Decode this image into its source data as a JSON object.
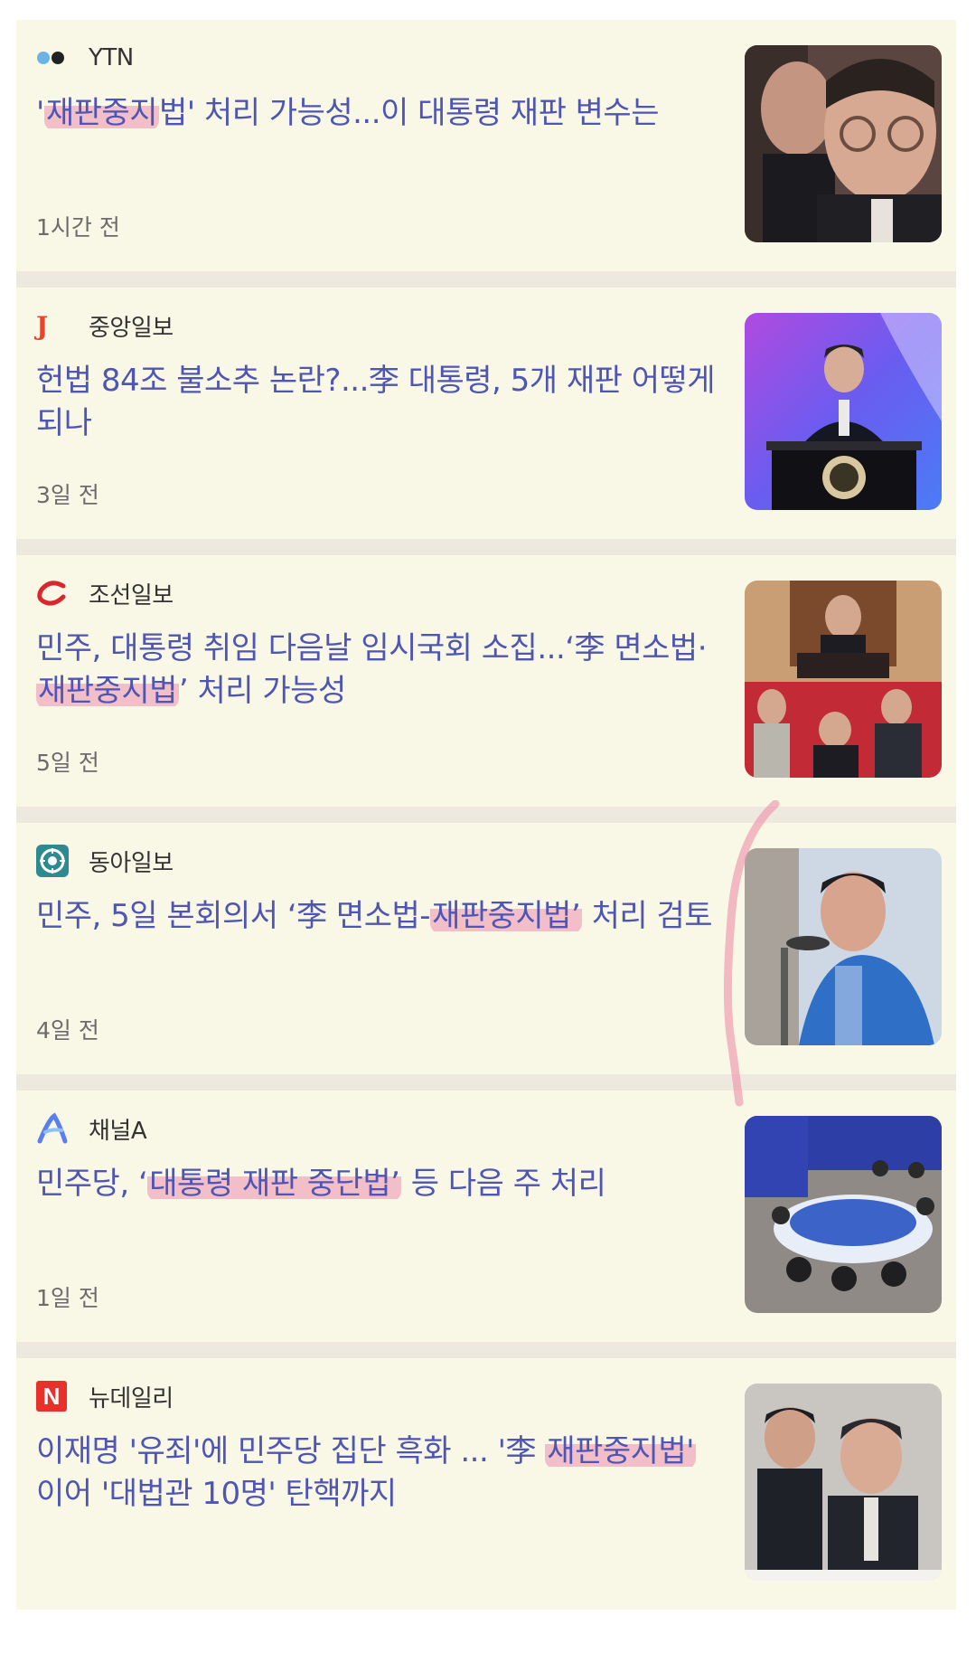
{
  "articles": [
    {
      "source": "YTN",
      "title_parts": [
        {
          "text": "'",
          "hl": false
        },
        {
          "text": "재판중지",
          "hl": true
        },
        {
          "text": "법' 처리 가능성...이 대통령 재판 변수는",
          "hl": false
        }
      ],
      "time": "1시간 전",
      "thumb_alt": "photo"
    },
    {
      "source": "중앙일보",
      "title_parts": [
        {
          "text": "헌법 84조 불소추 논란?...李 대통령, 5개 재판 어떻게 되나",
          "hl": false
        }
      ],
      "time": "3일 전",
      "thumb_alt": "photo"
    },
    {
      "source": "조선일보",
      "title_parts": [
        {
          "text": "민주, 대통령 취임 다음날 임시국회 소집...‘李 면소법·",
          "hl": false
        },
        {
          "text": "재판중지법",
          "hl": true
        },
        {
          "text": "’ 처리 가능성",
          "hl": false
        }
      ],
      "time": "5일 전",
      "thumb_alt": "photo"
    },
    {
      "source": "동아일보",
      "title_parts": [
        {
          "text": "민주, 5일 본회의서 ‘李 면소법-",
          "hl": false
        },
        {
          "text": "재판중지법’",
          "hl": true
        },
        {
          "text": " 처리 검토",
          "hl": false
        }
      ],
      "time": "4일 전",
      "thumb_alt": "photo"
    },
    {
      "source": "채널A",
      "title_parts": [
        {
          "text": "민주당, ‘",
          "hl": false
        },
        {
          "text": "대통령 재판 중단법’",
          "hl": true
        },
        {
          "text": " 등 다음 주 처리",
          "hl": false
        }
      ],
      "time": "1일 전",
      "thumb_alt": "photo"
    },
    {
      "source": "뉴데일리",
      "title_parts": [
        {
          "text": "이재명 '유죄'에 민주당 집단 흑화 ... '李 ",
          "hl": false
        },
        {
          "text": "재판중지법'",
          "hl": true
        },
        {
          "text": " 이어 '대법관 10명' 탄핵까지",
          "hl": false
        }
      ],
      "time": "",
      "thumb_alt": "photo"
    }
  ],
  "logos": {
    "ytn": "YTN-dots-icon",
    "joongang": "J",
    "chosun": "chosun-c-icon",
    "donga": "donga-emblem-icon",
    "channela": "A",
    "newdaily": "N"
  },
  "colors": {
    "title": "#4e55b3",
    "highlight": "#f0aabe",
    "card_bg": "#f9f8e6",
    "separator": "#ede9df"
  }
}
